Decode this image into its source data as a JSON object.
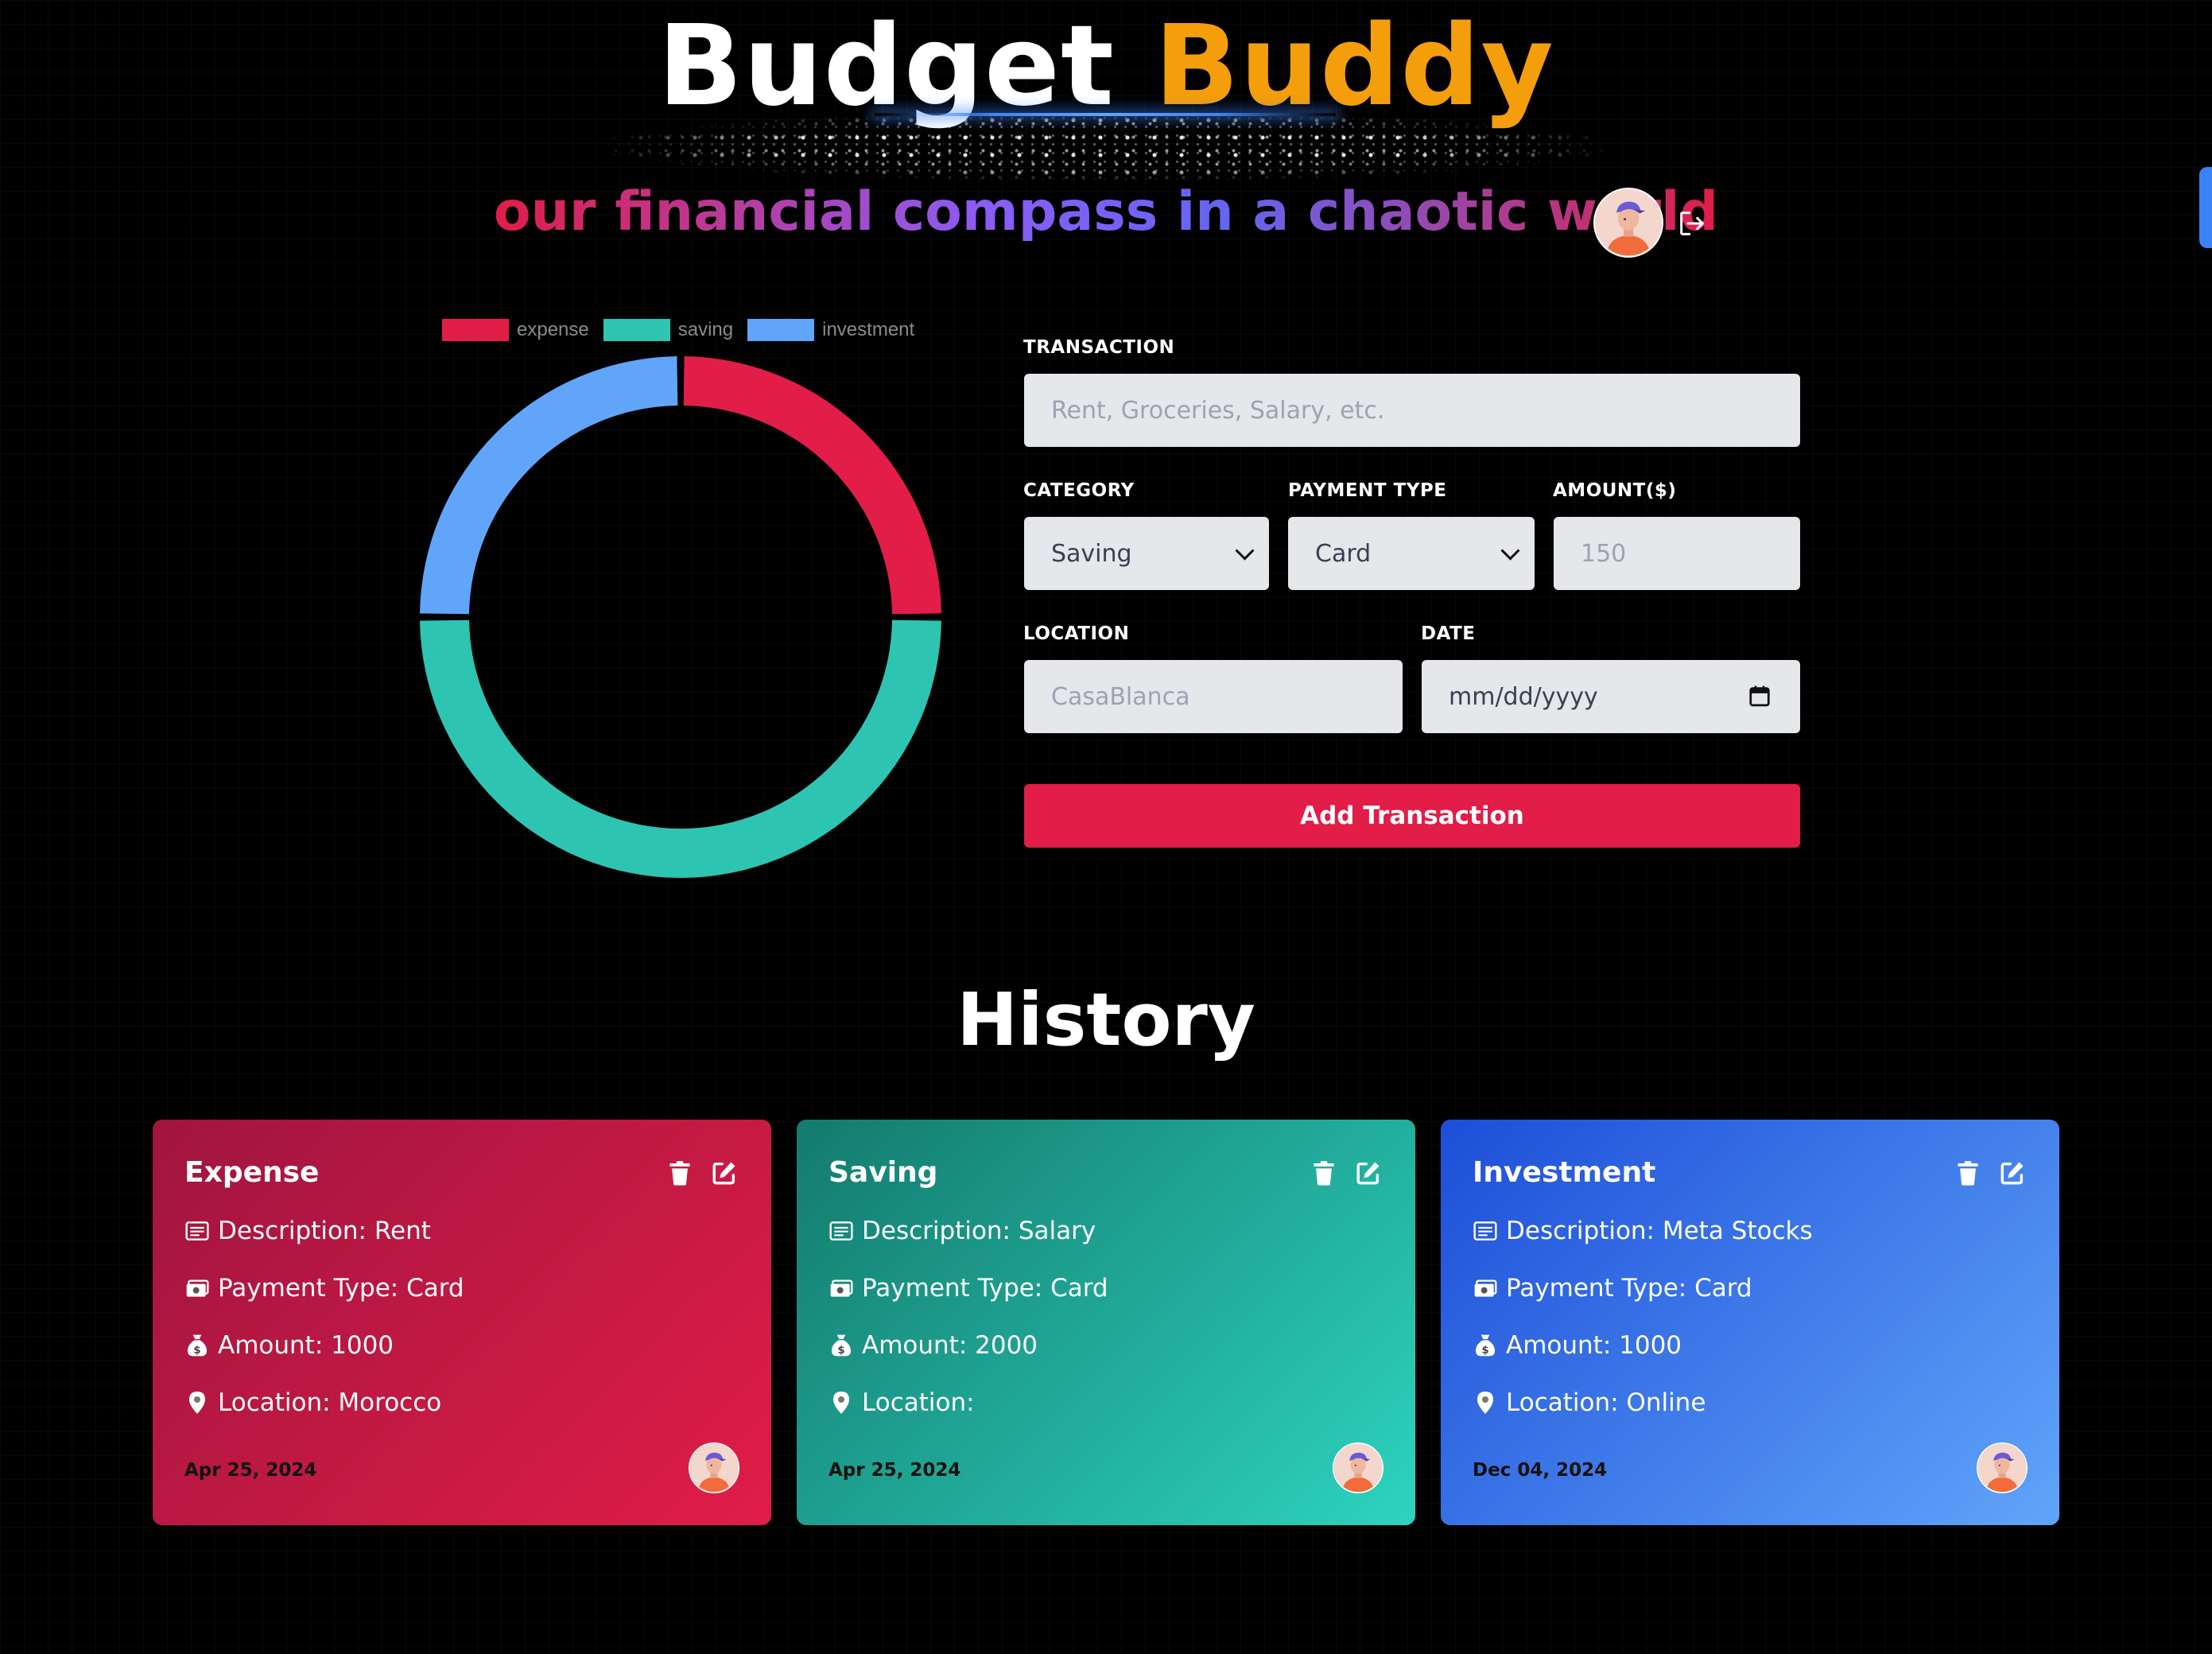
{
  "header": {
    "title_part1": "Budget",
    "title_part2": "Buddy",
    "subtitle": "our financial compass in a chaotic world",
    "accent_color": "#f59e0b"
  },
  "chart_data": {
    "type": "pie",
    "categories": [
      "expense",
      "saving",
      "investment"
    ],
    "values": [
      1000,
      2000,
      1000
    ],
    "colors": [
      "#e11d48",
      "#2dc4b2",
      "#60a5fa"
    ],
    "legend": "top"
  },
  "form": {
    "transaction_label": "TRANSACTION",
    "transaction_placeholder": "Rent, Groceries, Salary, etc.",
    "category_label": "CATEGORY",
    "category_value": "Saving",
    "payment_label": "PAYMENT TYPE",
    "payment_value": "Card",
    "amount_label": "AMOUNT($)",
    "amount_placeholder": "150",
    "location_label": "LOCATION",
    "location_placeholder": "CasaBlanca",
    "date_label": "DATE",
    "date_placeholder": "mm/dd/yyyy",
    "submit_label": "Add Transaction"
  },
  "history": {
    "title": "History",
    "cards": [
      {
        "title": "Expense",
        "description": "Description: Rent",
        "payment": "Payment Type: Card",
        "amount": "Amount: 1000",
        "location": "Location: Morocco",
        "date": "Apr 25, 2024"
      },
      {
        "title": "Saving",
        "description": "Description: Salary",
        "payment": "Payment Type: Card",
        "amount": "Amount: 2000",
        "location": "Location:",
        "date": "Apr 25, 2024"
      },
      {
        "title": "Investment",
        "description": "Description: Meta Stocks",
        "payment": "Payment Type: Card",
        "amount": "Amount: 1000",
        "location": "Location: Online",
        "date": "Dec 04, 2024"
      }
    ]
  },
  "icons": {
    "header_avatar": "avatar-icon",
    "logout": "logout-icon",
    "trash": "trash-icon",
    "edit": "edit-icon",
    "description": "list-icon",
    "payment": "money-icon",
    "amount": "money-bag-icon",
    "location": "map-pin-icon",
    "calendar": "calendar-icon",
    "chevron": "chevron-down-icon"
  }
}
